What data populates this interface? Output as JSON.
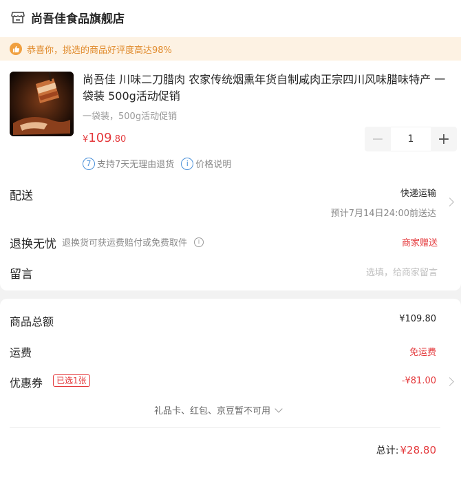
{
  "store": {
    "name": "尚吾佳食品旗舰店",
    "icon": "shop-icon"
  },
  "notice": {
    "text": "恭喜你，挑选的商品好评度高达98%",
    "icon": "thumbs-up-icon"
  },
  "product": {
    "title": "尚吾佳 川味二刀腊肉 农家传统烟熏年货自制咸肉正宗四川风味腊味特产 一袋装 500g活动促销",
    "spec": "一袋装，500g活动促销",
    "price_symbol": "¥",
    "price_int": "109",
    "price_dec": ".80",
    "quantity": "1",
    "minus_label": "−",
    "plus_label": "+"
  },
  "services": {
    "return_icon_text": "7",
    "return_text": "支持7天无理由退货",
    "price_icon_text": "i",
    "price_text": "价格说明"
  },
  "delivery": {
    "label": "配送",
    "method": "快递运输",
    "eta": "预计7月14日24:00前送达"
  },
  "return_worry": {
    "label": "退换无忧",
    "desc": "退换货可获运费赔付或免费取件",
    "value": "商家赠送"
  },
  "message": {
    "label": "留言",
    "placeholder": "选填，给商家留言"
  },
  "summary": {
    "goods_total_label": "商品总额",
    "goods_total_value": "¥109.80",
    "shipping_label": "运费",
    "shipping_value": "免运费",
    "coupon_label": "优惠券",
    "coupon_badge": "已选1张",
    "coupon_value": "-¥81.00",
    "unavailable_text": "礼品卡、红包、京豆暂不可用",
    "grand_total_label": "总计:",
    "grand_total_value": "¥28.80"
  },
  "colors": {
    "accent_red": "#e4393c",
    "notice_orange": "#e08a2b",
    "notice_bg": "#fdf2e3",
    "service_blue": "#4a90d9"
  }
}
